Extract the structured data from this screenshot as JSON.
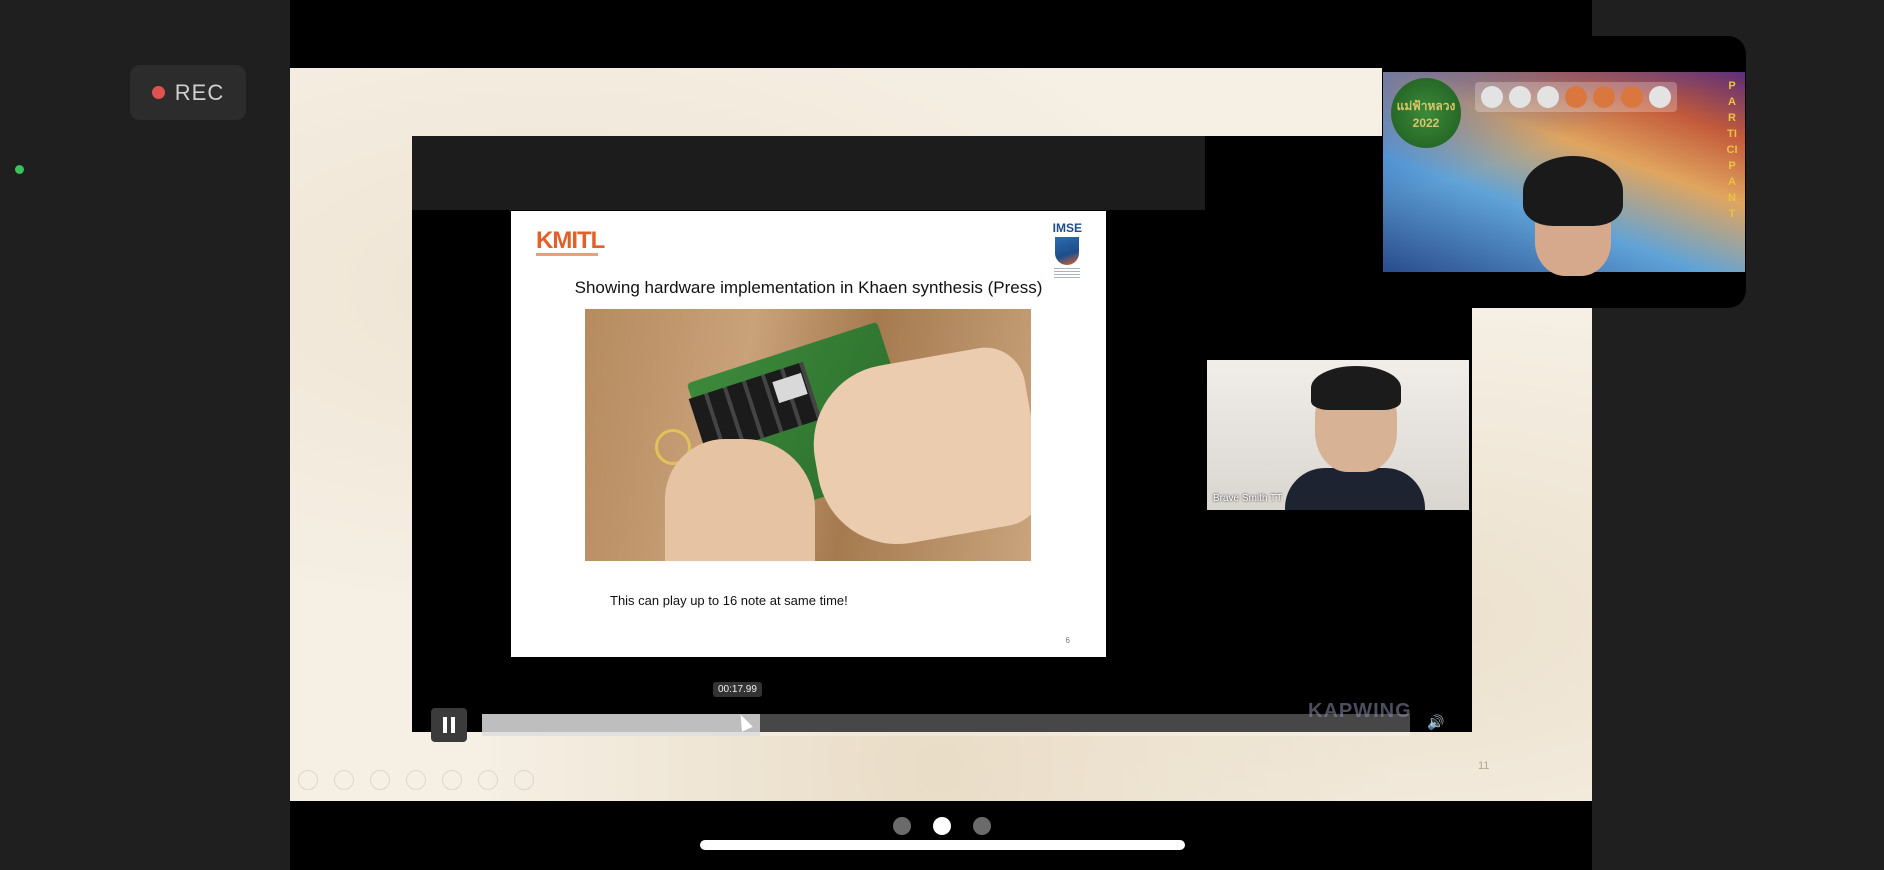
{
  "recording": {
    "label": "REC"
  },
  "slide": {
    "page_number": "11",
    "embedded_video": {
      "presentation": {
        "org_logo": "KMITL",
        "dept_logo": "IMSE",
        "title": "Showing hardware implementation in Khaen synthesis (Press)",
        "caption": "This can play up to 16 note at same time!",
        "slide_number": "6"
      },
      "participant_name": "Brave Smith TT",
      "player": {
        "time_tooltip": "00:17.99",
        "progress_fraction": 0.3,
        "watermark": "KAPWING"
      }
    }
  },
  "pip": {
    "logo_text": "แม่ฟ้าหลวง 2022",
    "vertical_banner": "PARTICIPANT"
  },
  "page_indicator": {
    "count": 3,
    "active_index": 1
  }
}
